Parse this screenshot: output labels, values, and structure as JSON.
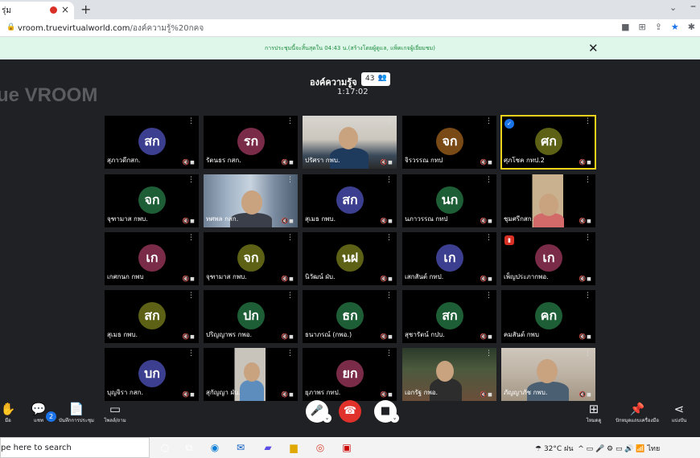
{
  "browser": {
    "tab_title": "รุ่ม",
    "tab_close": "×",
    "new_tab": "+",
    "url_host": "vroom.truevirtualworld.com",
    "url_path": "/องค์ความรู้%20กคจ"
  },
  "notice": {
    "text": "การประชุมนี้จะสิ้นสุดใน 04:43 น.(สร้างโดยผู้ดูแล, แพ็คเกจผู้เยี่ยมชม)",
    "close": "✕"
  },
  "header": {
    "logo": "ue VROOM",
    "title": "องค์ความรู้จ",
    "participant_count": "43",
    "timer": "1:17:02"
  },
  "tiles": [
    {
      "name": "สุภาวดีกสก.",
      "initials": "สก",
      "color": "#3c3f8f"
    },
    {
      "name": "รัตนธร กสก.",
      "initials": "รก",
      "color": "#7a2b47"
    },
    {
      "name": "ปรัศรา กพบ.",
      "initials": "",
      "color": ""
    },
    {
      "name": "จิรวรรณ กทป",
      "initials": "จก",
      "color": "#7a4a16"
    },
    {
      "name": "ศุภโชค กทป.2",
      "initials": "ศก",
      "color": "#5c6115"
    },
    {
      "name": "จุฑามาส กพบ.",
      "initials": "จก",
      "color": "#1e5e36"
    },
    {
      "name": "ทศพล กสก.",
      "initials": "",
      "color": ""
    },
    {
      "name": "สุเมธ กพบ.",
      "initials": "สก",
      "color": "#3c3f8f"
    },
    {
      "name": "นภาวรรณ กทป",
      "initials": "นก",
      "color": "#1e5e36"
    },
    {
      "name": "ชุมศรีกสก.",
      "initials": "",
      "color": ""
    },
    {
      "name": "เกศกนก กพบ",
      "initials": "เก",
      "color": "#7a2b47"
    },
    {
      "name": "จุฑามาส กพบ.",
      "initials": "จก",
      "color": "#5c6115"
    },
    {
      "name": "นิวัฒน์ ฝ่บ.",
      "initials": "นฝ",
      "color": "#5c6115"
    },
    {
      "name": "เสกสันต์ กทป.",
      "initials": "เก",
      "color": "#3c3f8f"
    },
    {
      "name": "เพ็ญประภากพอ.",
      "initials": "เก",
      "color": "#7a2b47"
    },
    {
      "name": "สุเมธ กพบ.",
      "initials": "สก",
      "color": "#5c6115"
    },
    {
      "name": "ปริญญาพร กพอ.",
      "initials": "ปก",
      "color": "#1e5e36"
    },
    {
      "name": "ธนาภรณ์ (กพอ.)",
      "initials": "ธก",
      "color": "#1e5e36"
    },
    {
      "name": "สุชารัตน์ กปบ.",
      "initials": "สก",
      "color": "#1e5e36"
    },
    {
      "name": "คมสันต์ กพบ",
      "initials": "คก",
      "color": "#1e5e36"
    },
    {
      "name": "บุญจิรา กสก.",
      "initials": "บก",
      "color": "#3c3f8f"
    },
    {
      "name": "สุกัญญา ฝ่บ.",
      "initials": "",
      "color": ""
    },
    {
      "name": "ยุภาพร กทป.",
      "initials": "ยก",
      "color": "#7a2b47"
    },
    {
      "name": "เอกรัฐ กพอ.",
      "initials": "",
      "color": ""
    },
    {
      "name": "ภัญญาภัช กพบ.",
      "initials": "",
      "color": ""
    }
  ],
  "toolbar": {
    "raise_hand": "มือ",
    "chat": "แชท",
    "chat_count": "2",
    "notes": "บันทึกการประชุม",
    "poll": "โพลล์/ถาม",
    "layout": "โหมดดู",
    "pin": "ปักหมุดแถบเครื่องมือ",
    "share": "แบ่งปัน"
  },
  "taskbar": {
    "search_placeholder": "pe here to search",
    "weather": "32°C ฝน",
    "lang": "ไทย"
  }
}
